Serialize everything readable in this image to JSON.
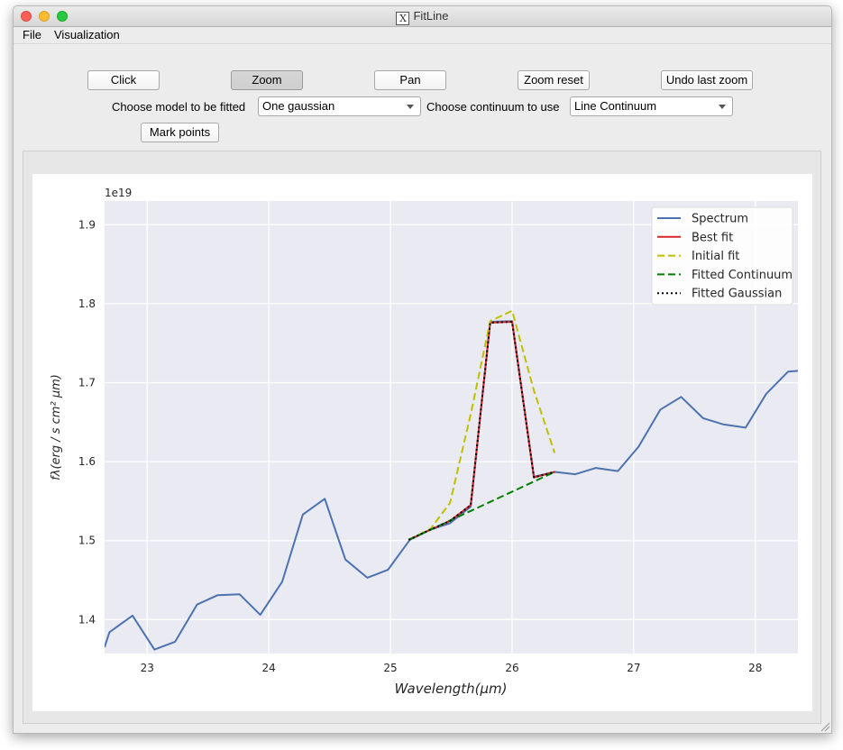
{
  "window": {
    "title": "FitLine",
    "app_icon": "x11-icon"
  },
  "menubar": {
    "items": [
      "File",
      "Visualization"
    ]
  },
  "toolbar": {
    "click_label": "Click",
    "zoom_label": "Zoom",
    "pan_label": "Pan",
    "zoom_reset_label": "Zoom reset",
    "undo_zoom_label": "Undo last zoom",
    "model_label": "Choose model to be fitted",
    "model_value": "One gaussian",
    "continuum_label": "Choose continuum to use",
    "continuum_value": "Line Continuum",
    "mark_points_label": "Mark points"
  },
  "colors": {
    "axes_bg": "#eaeaf2",
    "spectrum": "#4c72b0",
    "best_fit": "#d62728",
    "initial_fit": "#bfbf00",
    "continuum": "#008000",
    "gaussian": "#000000"
  },
  "chart_data": {
    "type": "line",
    "xlabel": "Wavelength(μm)",
    "ylabel": "fλ(erg / s cm² μm)",
    "y_scale_label": "1e19",
    "xlim": [
      22.65,
      28.35
    ],
    "ylim": [
      1.357,
      1.93
    ],
    "xticks": [
      23,
      24,
      25,
      26,
      27,
      28
    ],
    "yticks": [
      1.4,
      1.5,
      1.6,
      1.7,
      1.8,
      1.9
    ],
    "xtick_labels": [
      "23",
      "24",
      "25",
      "26",
      "27",
      "28"
    ],
    "ytick_labels": [
      "1.4",
      "1.5",
      "1.6",
      "1.7",
      "1.8",
      "1.9"
    ],
    "grid": true,
    "legend_position": "top-right",
    "series": [
      {
        "name": "Spectrum",
        "color": "#4c72b0",
        "style": "solid",
        "x": [
          22.65,
          22.69,
          22.88,
          23.06,
          23.23,
          23.41,
          23.58,
          23.76,
          23.93,
          24.11,
          24.28,
          24.46,
          24.63,
          24.81,
          24.98,
          25.16,
          25.33,
          25.49,
          25.66,
          25.82,
          26.0,
          26.18,
          26.35,
          26.52,
          26.69,
          26.87,
          27.04,
          27.22,
          27.39,
          27.57,
          27.74,
          27.92,
          28.09,
          28.27,
          28.35
        ],
        "y": [
          1.365,
          1.384,
          1.405,
          1.362,
          1.372,
          1.419,
          1.431,
          1.432,
          1.406,
          1.448,
          1.533,
          1.553,
          1.476,
          1.453,
          1.463,
          1.501,
          1.514,
          1.522,
          1.543,
          1.777,
          1.778,
          1.581,
          1.587,
          1.584,
          1.592,
          1.588,
          1.619,
          1.666,
          1.682,
          1.655,
          1.647,
          1.643,
          1.686,
          1.714,
          1.715
        ]
      },
      {
        "name": "Best fit",
        "color": "#d62728",
        "style": "solid",
        "x": [
          25.15,
          25.33,
          25.49,
          25.66,
          25.82,
          26.0,
          26.18,
          26.35
        ],
        "y": [
          1.501,
          1.514,
          1.525,
          1.545,
          1.776,
          1.777,
          1.58,
          1.587
        ]
      },
      {
        "name": "Initial fit",
        "color": "#bfbf00",
        "style": "dashed",
        "x": [
          25.15,
          25.33,
          25.49,
          25.66,
          25.82,
          26.0,
          26.18,
          26.35
        ],
        "y": [
          1.501,
          1.515,
          1.548,
          1.66,
          1.778,
          1.791,
          1.69,
          1.611
        ]
      },
      {
        "name": "Fitted Continuum",
        "color": "#008000",
        "style": "dashed",
        "x": [
          25.15,
          26.35
        ],
        "y": [
          1.501,
          1.587
        ]
      },
      {
        "name": "Fitted Gaussian",
        "color": "#000000",
        "style": "dotted",
        "x": [
          25.15,
          25.33,
          25.49,
          25.66,
          25.82,
          26.0,
          26.18,
          26.35
        ],
        "y": [
          1.501,
          1.514,
          1.525,
          1.545,
          1.776,
          1.777,
          1.58,
          1.587
        ]
      }
    ]
  }
}
